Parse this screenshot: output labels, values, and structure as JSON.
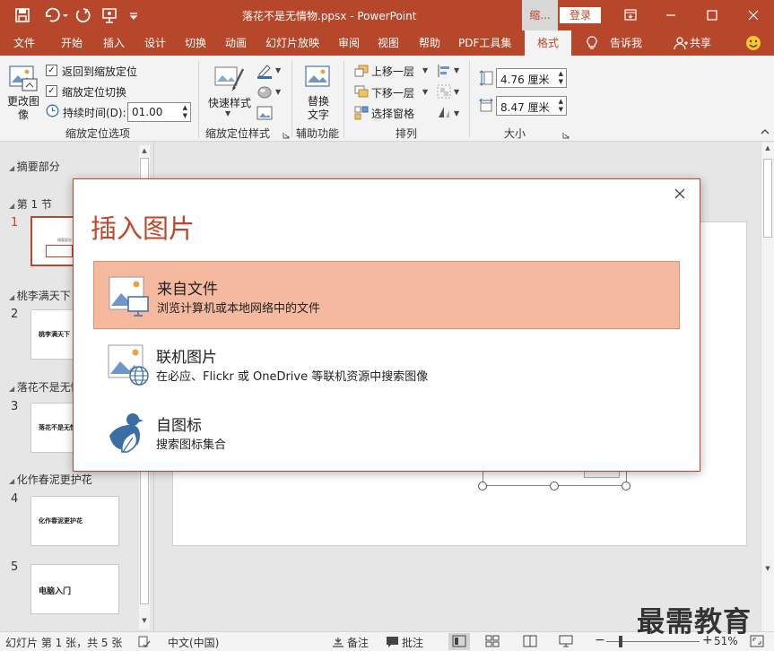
{
  "titlebar": {
    "document_title": "落花不是无情物.ppsx  -  PowerPoint",
    "context_tab": "缩...",
    "login": "登录"
  },
  "tabs": [
    "文件",
    "开始",
    "插入",
    "设计",
    "切换",
    "动画",
    "幻灯片放映",
    "审阅",
    "视图",
    "帮助",
    "PDF工具集",
    "格式"
  ],
  "tell_me": "告诉我",
  "share": "共享",
  "ribbon": {
    "change_image": "更改图像",
    "return_zoom": "返回到缩放定位",
    "zoom_transition": "缩放定位切换",
    "duration_label": "持续时间(D):",
    "duration_value": "01.00",
    "group_zoom_options": "缩放定位选项",
    "quick_styles": "快速样式",
    "group_zoom_styles": "缩放定位样式",
    "alt_text": "替换文字",
    "group_accessibility": "辅助功能",
    "bring_forward": "上移一层",
    "send_backward": "下移一层",
    "selection_pane": "选择窗格",
    "group_arrange": "排列",
    "height_value": "4.76 厘米",
    "width_value": "8.47 厘米",
    "group_size": "大小"
  },
  "slides_panel": {
    "sections": [
      {
        "name": "摘要部分"
      },
      {
        "name": "第 1 节"
      },
      {
        "name": "桃李满天下"
      },
      {
        "name": "落花不是无情物"
      },
      {
        "name": "化作春泥更护花"
      }
    ],
    "slides": [
      {
        "num": "1",
        "text": "摘要部分"
      },
      {
        "num": "2",
        "text": "桃李满天下"
      },
      {
        "num": "3",
        "text": "落花不是无情物"
      },
      {
        "num": "4",
        "text": "化作春泥更护花"
      },
      {
        "num": "5",
        "text": "电脑入门"
      }
    ]
  },
  "dialog": {
    "title": "插入图片",
    "options": [
      {
        "title": "来自文件",
        "desc": "浏览计算机或本地网络中的文件"
      },
      {
        "title": "联机图片",
        "desc": "在必应、Flickr 或 OneDrive 等联机资源中搜索图像"
      },
      {
        "title": "自图标",
        "desc": "搜索图标集合"
      }
    ]
  },
  "statusbar": {
    "slide_info": "幻灯片 第 1 张，共 5 张",
    "language": "中文(中国)",
    "notes": "备注",
    "comments": "批注",
    "zoom": "51%"
  },
  "watermark": "最需教育",
  "colors": {
    "accent": "#b7472a",
    "selected_option": "#f4b99e"
  }
}
